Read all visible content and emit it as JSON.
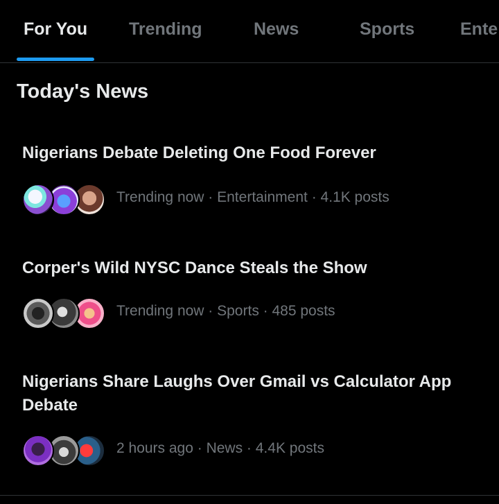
{
  "tabs": [
    {
      "label": "For You",
      "active": true
    },
    {
      "label": "Trending",
      "active": false
    },
    {
      "label": "News",
      "active": false
    },
    {
      "label": "Sports",
      "active": false
    },
    {
      "label": "Ente",
      "active": false
    }
  ],
  "section_title": "Today's News",
  "stories": [
    {
      "headline": "Nigerians Debate Deleting One Food Forever",
      "meta": "Trending now · Entertainment · 4.1K posts",
      "avatars": [
        "avatar-anime-character",
        "avatar-purple-character",
        "avatar-person-photo"
      ]
    },
    {
      "headline": "Corper's Wild NYSC Dance Steals the Show",
      "meta": "Trending now · Sports · 485 posts",
      "avatars": [
        "avatar-masked-person",
        "avatar-dark-figure",
        "avatar-pink-character"
      ]
    },
    {
      "headline": "Nigerians Share Laughs Over Gmail vs Calculator App Debate",
      "meta": "2 hours ago · News · 4.4K posts",
      "avatars": [
        "avatar-purple-portrait",
        "avatar-group-photo",
        "avatar-red-scene"
      ]
    }
  ],
  "colors": {
    "background": "#000000",
    "primary_text": "#e7e9ea",
    "secondary_text": "#71767b",
    "accent": "#1d9bf0",
    "divider": "#2f3336"
  }
}
